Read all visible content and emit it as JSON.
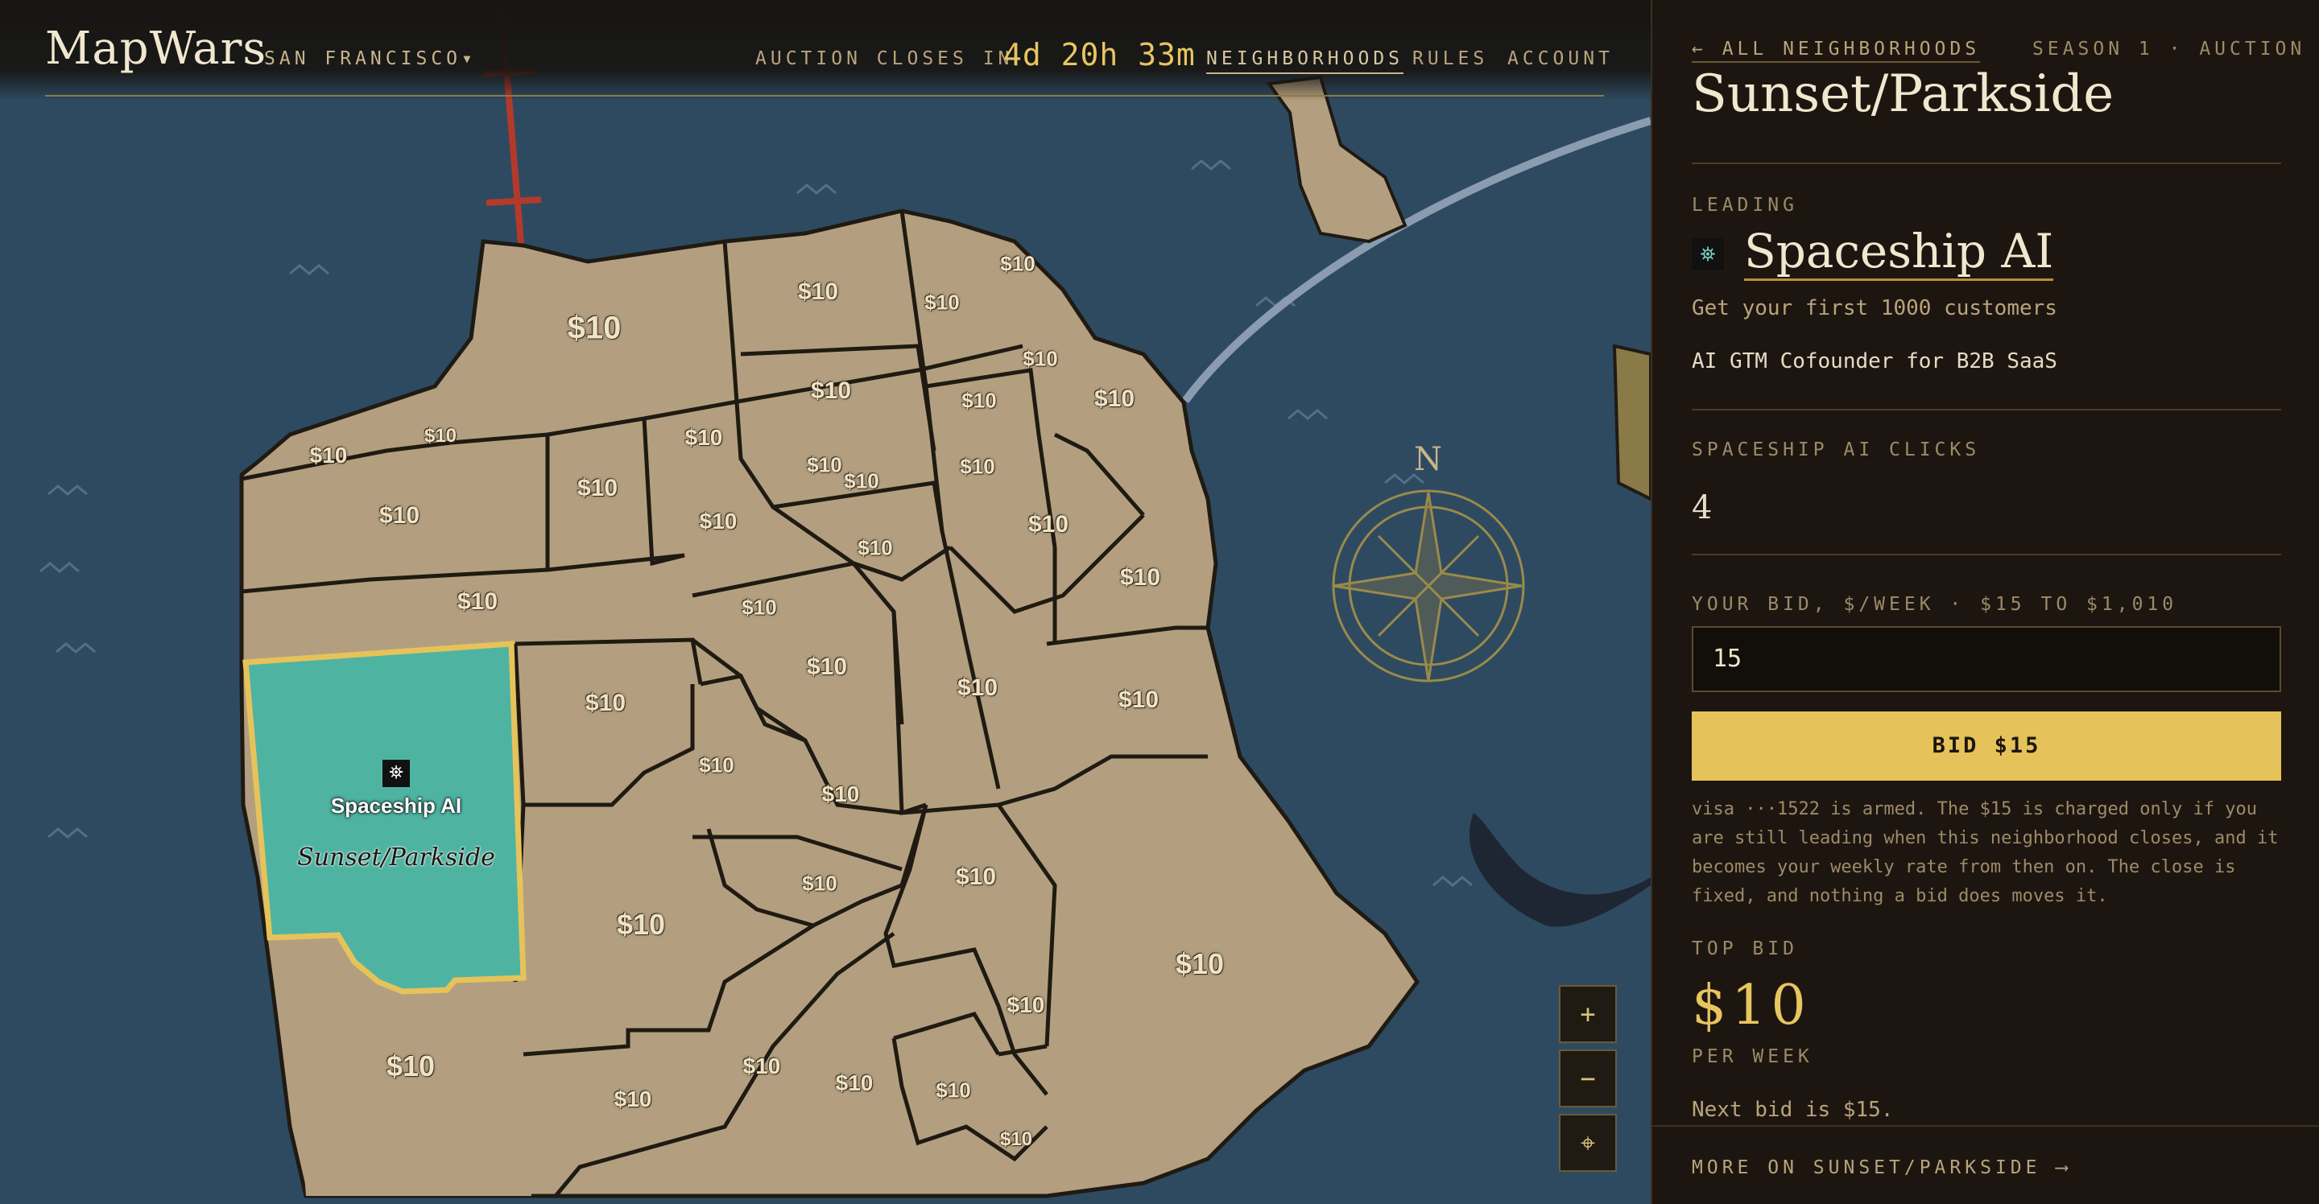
{
  "app": {
    "name": "MapWars",
    "city": "SAN FRANCISCO",
    "city_caret": "▾"
  },
  "nav": {
    "closes_label": "AUCTION CLOSES IN",
    "timer": "4d 20h 33m",
    "links": [
      "NEIGHBORHOODS",
      "RULES",
      "ACCOUNT"
    ]
  },
  "map": {
    "price_label": "$10",
    "selected": {
      "leader": "Spaceship AI",
      "name": "Sunset/Parkside"
    },
    "compass_letter": "N",
    "controls": {
      "zoom_in": "+",
      "zoom_out": "−",
      "locate": "⌖"
    }
  },
  "panel": {
    "back": "← ALL NEIGHBORHOODS",
    "season": "SEASON 1 · AUCTION",
    "neighborhood": "Sunset/Parkside",
    "leading_label": "LEADING",
    "leader_name": "Spaceship AI",
    "tagline": "Get your first 1000 customers",
    "description": "AI GTM Cofounder for B2B SaaS",
    "clicks_label": "SPACESHIP AI CLICKS",
    "clicks": "4",
    "bid_label": "YOUR BID, $/WEEK · $15 TO $1,010",
    "bid_value": "15",
    "bid_button": "BID $15",
    "note": "visa ···1522 is armed. The $15 is charged only if you are still leading when this neighborhood closes, and it becomes your weekly rate from then on. The close is fixed, and nothing a bid does moves it.",
    "top_bid_label": "TOP BID",
    "top_bid": "$10",
    "per_week": "PER WEEK",
    "next_bid": "Next bid is $15.",
    "more": "MORE ON SUNSET/PARKSIDE ⟶"
  },
  "colors": {
    "accent": "#e6c35a",
    "selected_fill": "#4fb3a2",
    "land": "#b39f7f",
    "water": "#2e4a61",
    "panel_bg": "#1d1610"
  }
}
